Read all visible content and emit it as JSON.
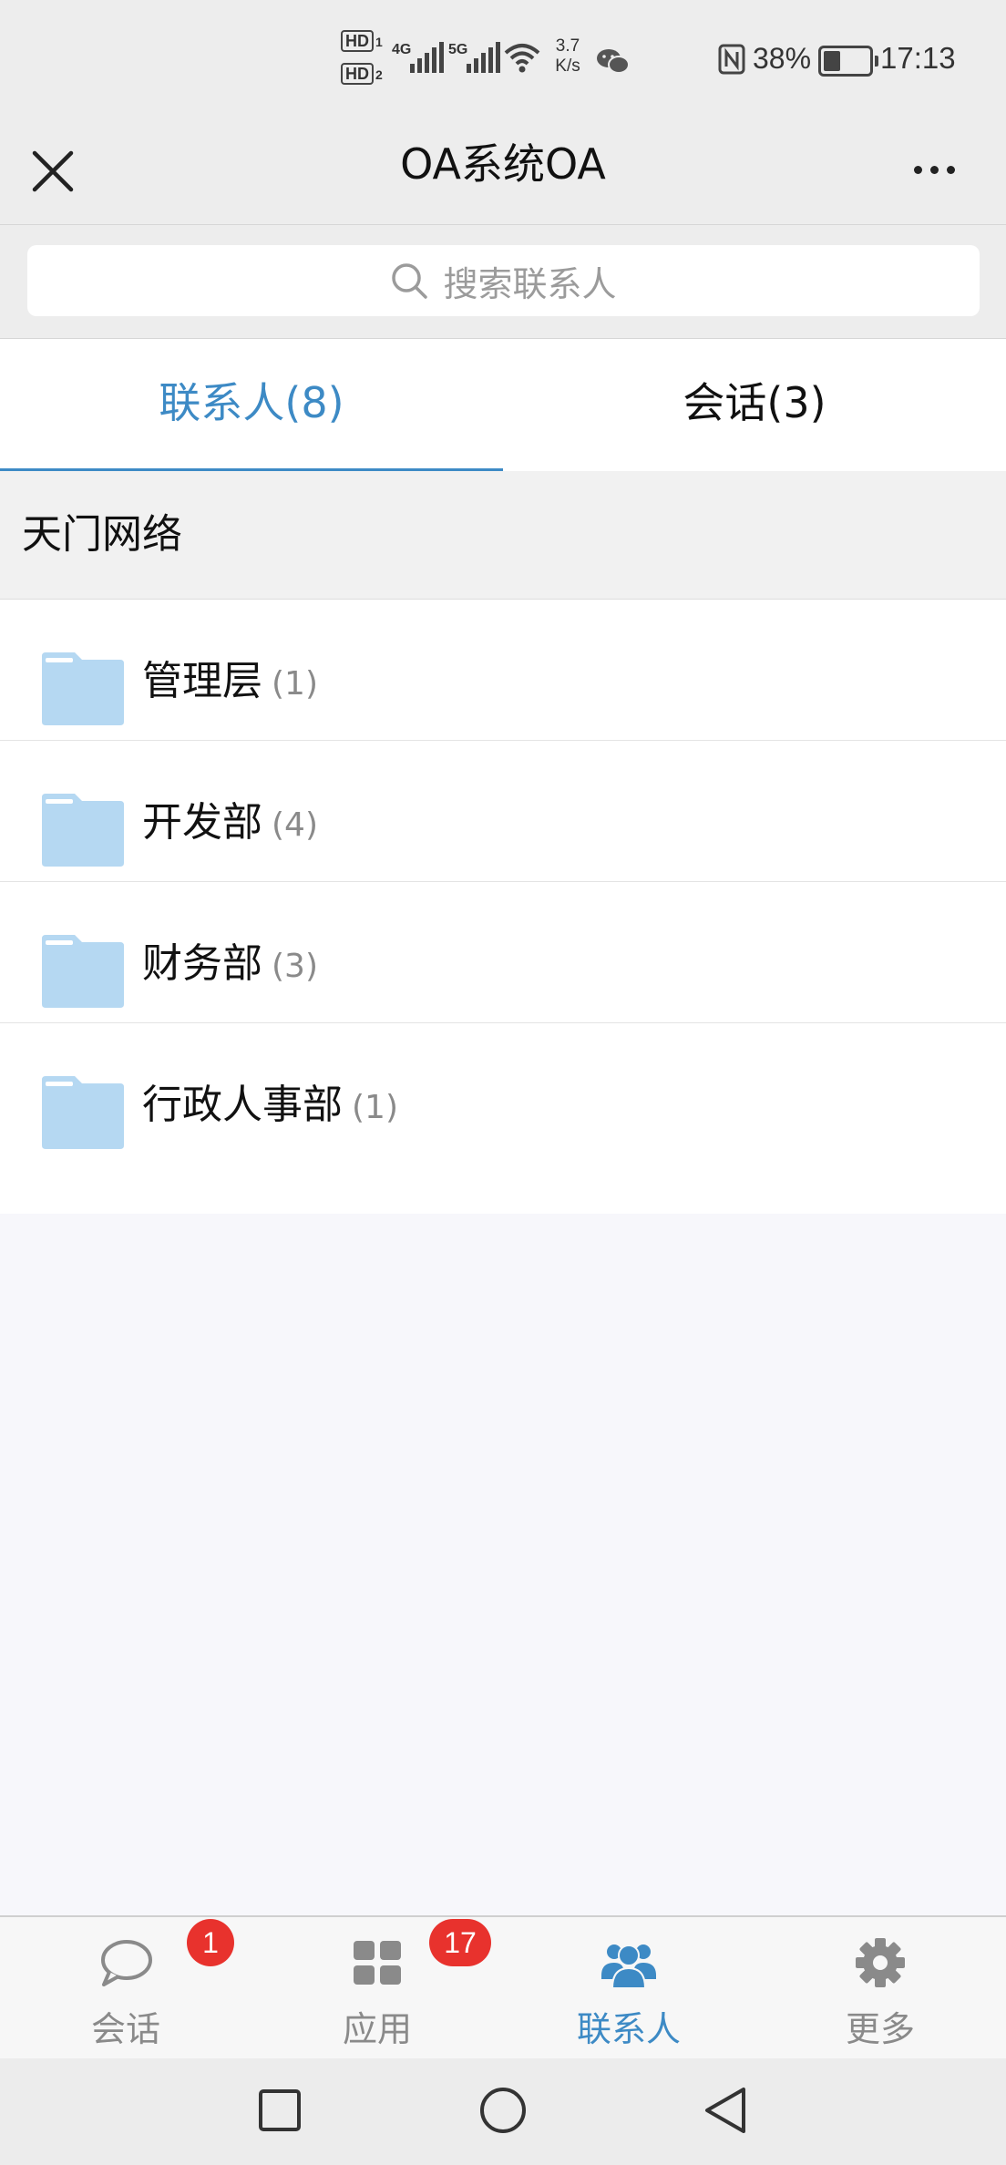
{
  "status_bar": {
    "hd1": "HD",
    "hd1_sub": "1",
    "hd2": "HD",
    "hd2_sub": "2",
    "net1": "4G",
    "net2": "5G",
    "speed_value": "3.7",
    "speed_unit": "K/s",
    "battery_percent": "38%",
    "battery_level": 0.38,
    "time": "17:13"
  },
  "header": {
    "title": "OA系统OA"
  },
  "search": {
    "placeholder": "搜索联系人"
  },
  "tabs": [
    {
      "label": "联系人(8)",
      "active": true
    },
    {
      "label": "会话(3)",
      "active": false
    }
  ],
  "organization": {
    "name": "天门网络"
  },
  "departments": [
    {
      "name": "管理层",
      "count": "(1)"
    },
    {
      "name": "开发部",
      "count": "(4)"
    },
    {
      "name": "财务部",
      "count": "(3)"
    },
    {
      "name": "行政人事部",
      "count": "(1)"
    }
  ],
  "bottom_nav": [
    {
      "label": "会话",
      "icon": "chat-bubble-icon",
      "badge": "1",
      "active": false
    },
    {
      "label": "应用",
      "icon": "apps-grid-icon",
      "badge": "17",
      "active": false
    },
    {
      "label": "联系人",
      "icon": "contacts-group-icon",
      "badge": "",
      "active": true
    },
    {
      "label": "更多",
      "icon": "gear-icon",
      "badge": "",
      "active": false
    }
  ],
  "colors": {
    "accent": "#3d8ac5",
    "folder": "#b5d8f2",
    "badge": "#e8322d",
    "header_bg": "#ededed"
  }
}
